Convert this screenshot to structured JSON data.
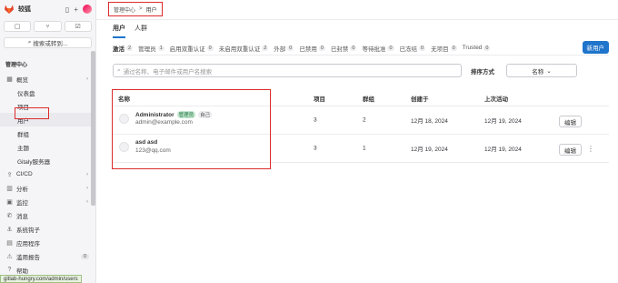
{
  "sidebar": {
    "brand": "较狐",
    "search_label": "搜索或转到...",
    "section_title": "管理中心",
    "items": [
      {
        "label": "概览",
        "icon": "grid-icon",
        "sub": false,
        "chevron": true
      },
      {
        "label": "仪表盘",
        "sub": true
      },
      {
        "label": "项目",
        "sub": true
      },
      {
        "label": "用户",
        "sub": true,
        "active": true
      },
      {
        "label": "群组",
        "sub": true
      },
      {
        "label": "主题",
        "sub": true
      },
      {
        "label": "Gitaly服务器",
        "sub": true
      },
      {
        "label": "CI/CD",
        "icon": "rocket-icon",
        "sub": false,
        "chevron": true
      },
      {
        "label": "分析",
        "icon": "chart-icon",
        "sub": false,
        "chevron": true
      },
      {
        "label": "监控",
        "icon": "monitor-icon",
        "sub": false,
        "chevron": true
      },
      {
        "label": "消息",
        "icon": "bullhorn-icon",
        "sub": false
      },
      {
        "label": "系统钩子",
        "icon": "hook-icon",
        "sub": false
      },
      {
        "label": "应用程序",
        "icon": "apps-icon",
        "sub": false
      },
      {
        "label": "滥用报告",
        "icon": "warning-icon",
        "sub": false,
        "count": "0"
      },
      {
        "label": "帮助",
        "icon": "help-icon",
        "sub": false
      }
    ]
  },
  "status_url": "gitlab-hungry.com/admin/users",
  "breadcrumb": {
    "parent": "管理中心",
    "separator": ">",
    "current": "用户"
  },
  "tabs": [
    {
      "label": "用户",
      "active": true
    },
    {
      "label": "人群",
      "active": false
    }
  ],
  "filters": [
    {
      "label": "激活",
      "count": "2",
      "active": true
    },
    {
      "label": "管理员",
      "count": "1"
    },
    {
      "label": "启用双重认证",
      "count": "0"
    },
    {
      "label": "未启用双重认证",
      "count": "2"
    },
    {
      "label": "外部",
      "count": "0"
    },
    {
      "label": "已禁用",
      "count": "0"
    },
    {
      "label": "已封禁",
      "count": "0"
    },
    {
      "label": "等待批准",
      "count": "0"
    },
    {
      "label": "已冻结",
      "count": "0"
    },
    {
      "label": "无项目",
      "count": "0"
    },
    {
      "label": "Trusted",
      "count": "0"
    }
  ],
  "new_user_label": "新用户",
  "search": {
    "placeholder": "通过名称、电子邮件或用户名搜索"
  },
  "sort": {
    "label": "排序方式",
    "value": "名称"
  },
  "table": {
    "headers": {
      "name": "名称",
      "projects": "项目",
      "groups": "群组",
      "created": "创建于",
      "last_activity": "上次活动"
    },
    "rows": [
      {
        "name": "Administrator",
        "badges": [
          "管理员",
          "自己"
        ],
        "email": "admin@example.com",
        "projects": "3",
        "groups": "2",
        "created": "12月 18, 2024",
        "last_activity": "12月 19, 2024",
        "action": "编辑"
      },
      {
        "name": "asd asd",
        "badges": [],
        "email": "123@qq.com",
        "projects": "3",
        "groups": "1",
        "created": "12月 19, 2024",
        "last_activity": "12月 19, 2024",
        "action": "编辑"
      }
    ]
  },
  "colors": {
    "accent": "#1f75cb",
    "highlight": "#dd2b2b",
    "admin_badge": "#c3e6cd"
  }
}
